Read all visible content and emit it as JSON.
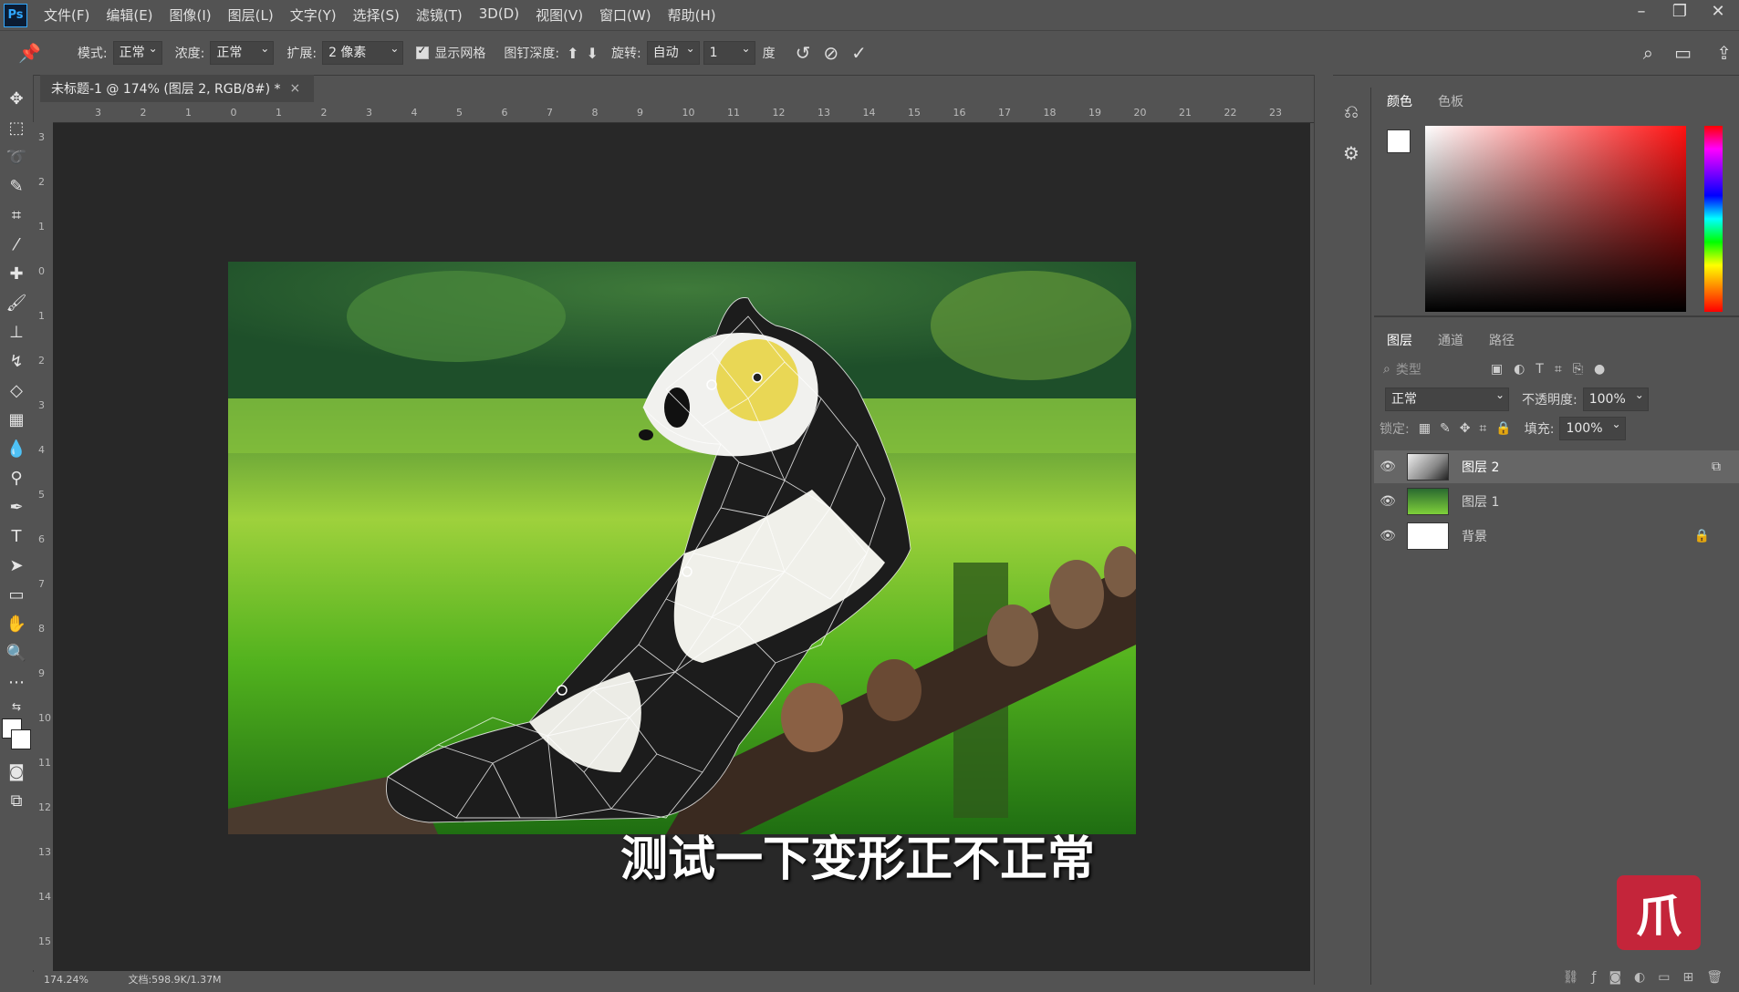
{
  "app": {
    "logo": "Ps"
  },
  "menu": [
    "文件(F)",
    "编辑(E)",
    "图像(I)",
    "图层(L)",
    "文字(Y)",
    "选择(S)",
    "滤镜(T)",
    "3D(D)",
    "视图(V)",
    "窗口(W)",
    "帮助(H)"
  ],
  "options": {
    "mode_label": "模式:",
    "mode_value": "正常",
    "density_label": "浓度:",
    "density_value": "正常",
    "expand_label": "扩展:",
    "expand_value": "2 像素",
    "show_mesh_label": "显示网格",
    "pin_depth_label": "图钉深度:",
    "rotate_label": "旋转:",
    "rotate_value": "自动",
    "rotate_amount": "1",
    "rotate_unit": "度"
  },
  "document": {
    "tab_title": "未标题-1 @ 174% (图层 2, RGB/8#) *",
    "close_label": "×"
  },
  "ruler_top": [
    "3",
    "2",
    "1",
    "0",
    "1",
    "2",
    "3",
    "4",
    "5",
    "6",
    "7",
    "8",
    "9",
    "10",
    "11",
    "12",
    "13",
    "14",
    "15",
    "16",
    "17",
    "18",
    "19",
    "20",
    "21",
    "22",
    "23"
  ],
  "ruler_left": [
    "3",
    "2",
    "1",
    "0",
    "1",
    "2",
    "3",
    "4",
    "5",
    "6",
    "7",
    "8",
    "9",
    "10",
    "11",
    "12",
    "13",
    "14",
    "15"
  ],
  "statusbar": {
    "zoom": "174.24%",
    "doc": "文档:598.9K/1.37M"
  },
  "color_panel": {
    "tabs": [
      "颜色",
      "色板"
    ]
  },
  "layers_panel": {
    "tabs": [
      "图层",
      "通道",
      "路径"
    ],
    "filter_placeholder": "类型",
    "blend_mode": "正常",
    "opacity_label": "不透明度:",
    "opacity_value": "100%",
    "lock_label": "锁定:",
    "fill_label": "填充:",
    "fill_value": "100%",
    "layers": [
      {
        "name": "图层 2",
        "selected": true
      },
      {
        "name": "图层 1",
        "selected": false
      },
      {
        "name": "背景",
        "selected": false,
        "locked": true
      }
    ]
  },
  "subtitle": "测试一下变形正不正常",
  "watermark": "爪"
}
